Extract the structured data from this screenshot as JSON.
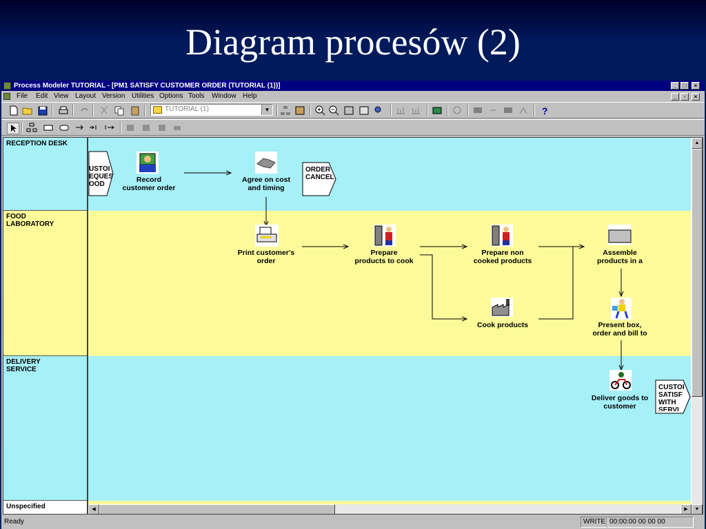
{
  "slide": {
    "title": "Diagram procesów (2)"
  },
  "window": {
    "title": "Process Modeler TUTORIAL - [PM1 SATISFY CUSTOMER ORDER (TUTORIAL (1))]",
    "menu": [
      "File",
      "Edit",
      "View",
      "Layout",
      "Version",
      "Utilities",
      "Options",
      "Tools",
      "Window",
      "Help"
    ],
    "model_combo": "TUTORIAL (1)"
  },
  "lanes": [
    {
      "label": "RECEPTION DESK",
      "color": "#a6f0f8"
    },
    {
      "label": "FOOD\nLABORATORY",
      "color": "#fdfa9a"
    },
    {
      "label": "DELIVERY\nSERVICE",
      "color": "#a6f0f8"
    },
    {
      "label": "Unspecified",
      "color": "#fdfa9a"
    }
  ],
  "processes": {
    "record": {
      "label": "Record\ncustomer order",
      "icon": "receptionist-icon"
    },
    "agree": {
      "label": "Agree on cost\nand timing",
      "icon": "handshake-icon"
    },
    "print": {
      "label": "Print customer's\norder",
      "icon": "printer-icon"
    },
    "prepare": {
      "label": "Prepare\nproducts to cook",
      "icon": "worker-shelf-icon"
    },
    "noncooked": {
      "label": "Prepare non\ncooked products",
      "icon": "worker-shelf-icon"
    },
    "assemble": {
      "label": "Assemble\nproducts in a",
      "icon": "box-icon"
    },
    "cook": {
      "label": "Cook products",
      "icon": "factory-icon"
    },
    "present": {
      "label": "Present box,\norder and bill to",
      "icon": "person-icon"
    },
    "deliver": {
      "label": "Deliver goods to\ncustomer",
      "icon": "motorbike-icon"
    }
  },
  "events": {
    "incoming": "USTOI\nEQUES\nOOD",
    "cancel": "ORDER\nCANCEL",
    "satisfied": "CUSTOI\nSATISF\nWITH\nSERVI"
  },
  "status": {
    "ready": "Ready",
    "mode": "WRITE",
    "time": "00:00:00 00 00 00"
  },
  "colors": {
    "slide_bg": "#001a5c",
    "lane_cyan": "#a6f0f8",
    "lane_yellow": "#fdfa9a",
    "titlebar": "#000080"
  }
}
